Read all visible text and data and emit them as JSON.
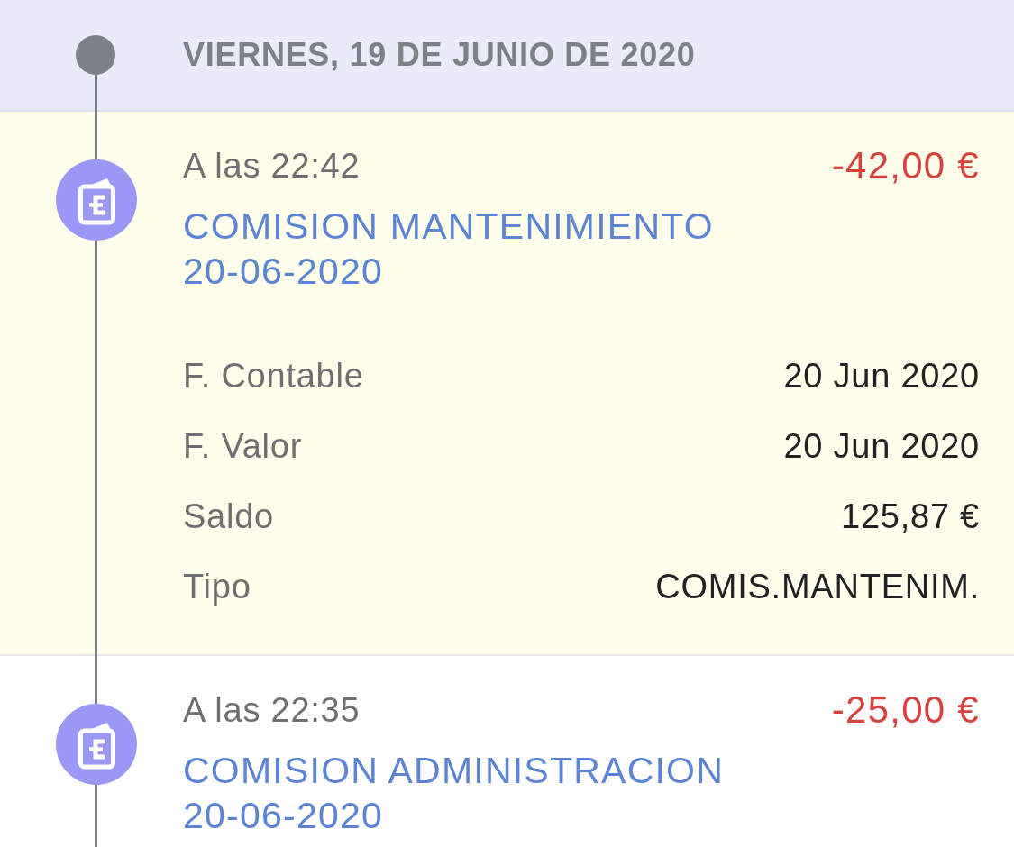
{
  "day_header": {
    "date": "VIERNES, 19 DE JUNIO DE 2020"
  },
  "transactions": [
    {
      "time": "A las 22:42",
      "amount": "-42,00 €",
      "title": "COMISION MANTENIMIENTO 20-06-2020",
      "expanded": true,
      "details": [
        {
          "label": "F. Contable",
          "value": "20 Jun 2020"
        },
        {
          "label": "F. Valor",
          "value": "20 Jun 2020"
        },
        {
          "label": "Saldo",
          "value": "125,87 €"
        },
        {
          "label": "Tipo",
          "value": "COMIS.MANTENIM."
        }
      ]
    },
    {
      "time": "A las 22:35",
      "amount": "-25,00 €",
      "title": "COMISION ADMINISTRACION 20-06-2020",
      "expanded": false
    }
  ]
}
